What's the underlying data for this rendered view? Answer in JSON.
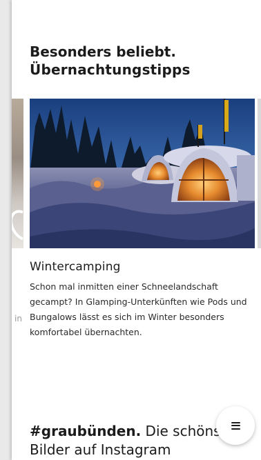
{
  "section": {
    "title_bold": "Besonders beliebt.",
    "title_light": "Übernachtungstipps"
  },
  "card": {
    "title": "Wintercamping",
    "text": "Schon mal inmitten einer Schneelandschaft gecampt? In Glamping-Unterkünften wie Pods und Bungalows lässt es sich im Winter besonders komfortabel übernachten."
  },
  "prev_card_fragment": "in",
  "instagram": {
    "title_bold": "#graubünden.",
    "title_light": "Die schönsten Bilder auf Instagram"
  },
  "menu_button": {
    "icon": "hamburger-menu-icon"
  }
}
